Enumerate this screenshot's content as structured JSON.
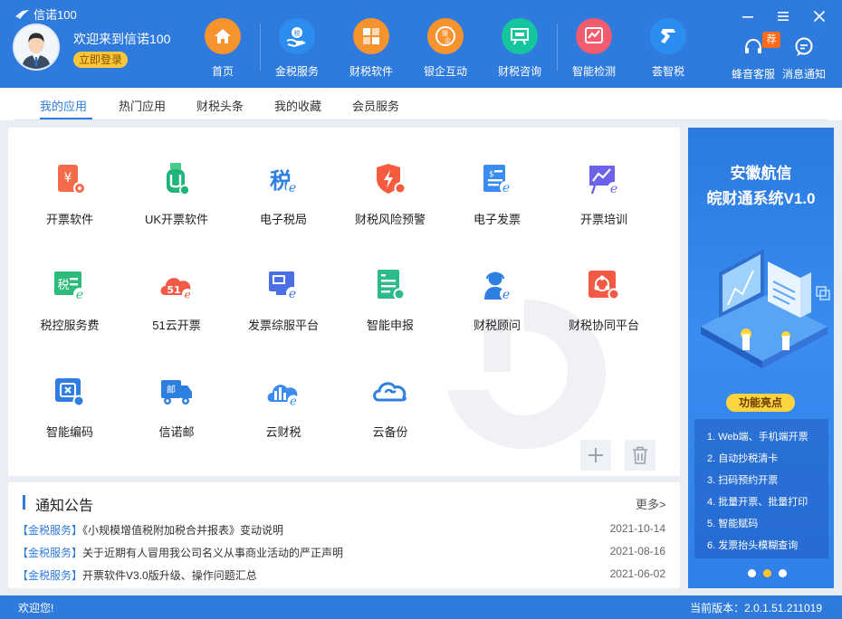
{
  "window": {
    "title": "信诺100"
  },
  "user": {
    "welcome": "欢迎来到信诺100",
    "login_label": "立即登录"
  },
  "nav": [
    {
      "label": "首页",
      "icon": "home-icon",
      "color": "#f7932f"
    },
    {
      "label": "金税服务",
      "icon": "tax-hand-icon",
      "color": "#2c8df0"
    },
    {
      "label": "财税软件",
      "icon": "software-grid-icon",
      "color": "#f7932f"
    },
    {
      "label": "银企互动",
      "icon": "bank-enterprise-icon",
      "color": "#f7932f"
    },
    {
      "label": "财税咨询",
      "icon": "consult-board-icon",
      "color": "#15c59b"
    },
    {
      "label": "智能检测",
      "icon": "chart-detect-icon",
      "color": "#f25c6e"
    },
    {
      "label": "荟智税",
      "icon": "smart-tax-icon",
      "color": "#2c8df0"
    }
  ],
  "right_tools": {
    "service": "蜂音客服",
    "service_badge": "荐",
    "notice": "消息通知"
  },
  "tabs": [
    "我的应用",
    "热门应用",
    "财税头条",
    "我的收藏",
    "会员服务"
  ],
  "apps": [
    {
      "label": "开票软件",
      "icon": "invoice-software-icon"
    },
    {
      "label": "UK开票软件",
      "icon": "uk-key-icon"
    },
    {
      "label": "电子税局",
      "icon": "e-tax-bureau-icon"
    },
    {
      "label": "财税风险预警",
      "icon": "risk-warning-icon"
    },
    {
      "label": "电子发票",
      "icon": "e-invoice-icon"
    },
    {
      "label": "开票培训",
      "icon": "training-icon"
    },
    {
      "label": "税控服务费",
      "icon": "tax-control-fee-icon"
    },
    {
      "label": "51云开票",
      "icon": "cloud-51-icon"
    },
    {
      "label": "发票综服平台",
      "icon": "invoice-platform-icon"
    },
    {
      "label": "智能申报",
      "icon": "smart-declare-icon"
    },
    {
      "label": "财税顾问",
      "icon": "advisor-icon"
    },
    {
      "label": "财税协同平台",
      "icon": "collab-platform-icon"
    },
    {
      "label": "智能编码",
      "icon": "smart-code-icon"
    },
    {
      "label": "信诺邮",
      "icon": "mail-truck-icon"
    },
    {
      "label": "云财税",
      "icon": "cloud-finance-icon"
    },
    {
      "label": "云备份",
      "icon": "cloud-backup-icon"
    }
  ],
  "notice": {
    "title": "通知公告",
    "more": "更多>",
    "items": [
      {
        "tag": "【金税服务】",
        "text": "《小规模增值税附加税合并报表》变动说明",
        "date": "2021-10-14"
      },
      {
        "tag": "【金税服务】",
        "text": "关于近期有人冒用我公司名义从事商业活动的严正声明",
        "date": "2021-08-16"
      },
      {
        "tag": "【金税服务】",
        "text": "开票软件V3.0版升级、操作问题汇总",
        "date": "2021-06-02"
      }
    ]
  },
  "banner": {
    "title1": "安徽航信",
    "title2": "皖财通系统V1.0",
    "feature_label": "功能亮点",
    "features": [
      "1. Web端、手机端开票",
      "2. 自动抄税清卡",
      "3. 扫码预约开票",
      "4. 批量开票、批量打印",
      "5. 智能赋码",
      "6. 发票抬头模糊查询"
    ]
  },
  "status": {
    "left": "欢迎您!",
    "version_label": "当前版本：",
    "version": "2.0.1.51.211019"
  }
}
